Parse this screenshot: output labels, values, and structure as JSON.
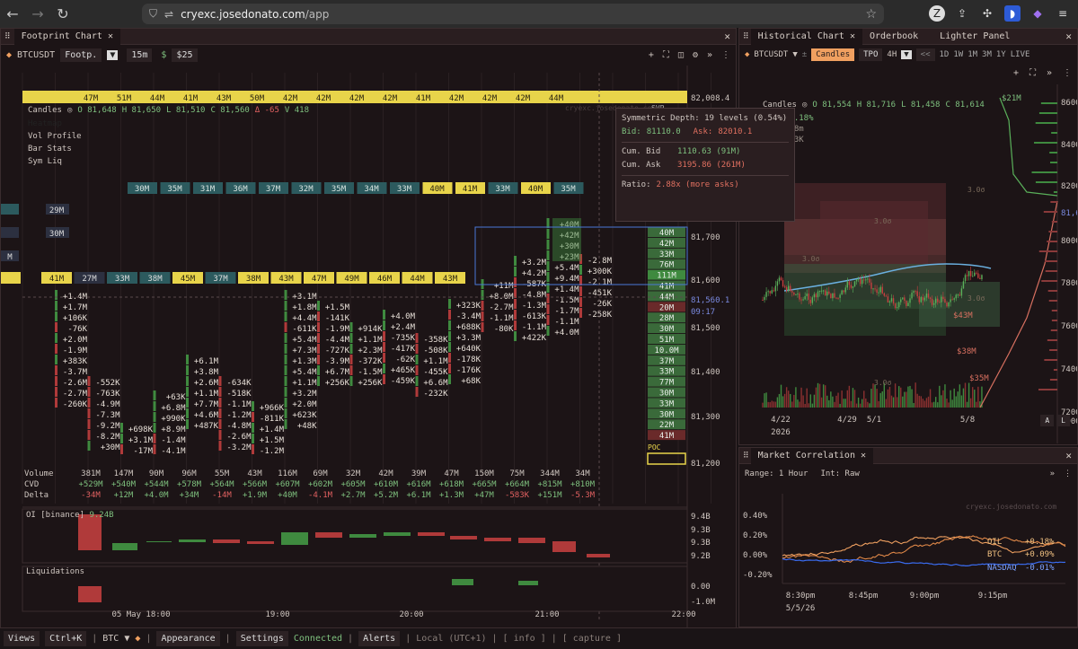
{
  "browser": {
    "url_domain": "cryexc.josedonato.com",
    "url_path": "/app",
    "back": "←",
    "forward": "→",
    "reload": "↻"
  },
  "left_panel": {
    "tab_label": "Footprint Chart",
    "symbol": "BTCUSDT",
    "mode": "Footp.",
    "interval": "15m",
    "currency_sign": "$",
    "step": "$25",
    "watermark": "cryexc.josedonato.com",
    "ohlc": {
      "label": "Candles",
      "o": "O 81,648",
      "h": "H 81,650",
      "l": "L 81,510",
      "c": "C 81,560",
      "d": "Δ -65",
      "v": "V 418"
    },
    "layers": [
      "Heatmap",
      "Vol Profile",
      "Bar Stats",
      "Sym Liq"
    ],
    "svp": "SVP",
    "tooltip": {
      "title": "Symmetric Depth: 19 levels (0.54%)",
      "bid_label": "Bid:",
      "bid": "81110.0",
      "ask_label": "Ask:",
      "ask": "82010.1",
      "cum_bid_label": "Cum. Bid",
      "cum_bid": "1110.63 (91M)",
      "cum_ask_label": "Cum. Ask",
      "cum_ask": "3195.86 (261M)",
      "ratio_label": "Ratio:",
      "ratio": "2.88x (more asks)"
    },
    "price_axis": [
      "82,008.4",
      "81,700",
      "81,600",
      "81,560.1",
      "09:17",
      "81,500",
      "81,400",
      "81,300",
      "81,200"
    ],
    "top_strip": [
      "47M",
      "51M",
      "44M",
      "41M",
      "43M",
      "50M",
      "42M",
      "42M",
      "42M",
      "42M",
      "41M",
      "42M",
      "42M",
      "42M",
      "44M"
    ],
    "mid_strip": [
      "30M",
      "35M",
      "31M",
      "36M",
      "37M",
      "32M",
      "35M",
      "34M",
      "33M",
      "40M",
      "41M",
      "33M",
      "40M",
      "35M"
    ],
    "low_strip": [
      "41M",
      "27M",
      "33M",
      "38M",
      "45M",
      "37M",
      "38M",
      "43M",
      "47M",
      "49M",
      "46M",
      "44M",
      "43M"
    ],
    "left_tags": [
      "29M",
      "30M",
      "M"
    ],
    "vp_values": [
      "40M",
      "42M",
      "33M",
      "76M",
      "111M",
      "41M",
      "44M",
      "20M",
      "28M",
      "30M",
      "51M",
      "10.0M",
      "37M",
      "33M",
      "77M",
      "30M",
      "33M",
      "30M",
      "22M",
      "41M"
    ],
    "poc_label": "POC",
    "stats_labels": [
      "Volume",
      "CVD",
      "Delta"
    ],
    "volume": [
      "381M",
      "147M",
      "90M",
      "96M",
      "55M",
      "43M",
      "116M",
      "69M",
      "32M",
      "42M",
      "39M",
      "47M",
      "150M",
      "75M",
      "344M",
      "34M"
    ],
    "cvd": [
      "+529M",
      "+540M",
      "+544M",
      "+578M",
      "+564M",
      "+566M",
      "+607M",
      "+602M",
      "+605M",
      "+610M",
      "+616M",
      "+618M",
      "+665M",
      "+664M",
      "+815M",
      "+810M"
    ],
    "delta": [
      "-34M",
      "+12M",
      "+4.0M",
      "+34M",
      "-14M",
      "+1.9M",
      "+40M",
      "-4.1M",
      "+2.7M",
      "+5.2M",
      "+6.1M",
      "+1.3M",
      "+47M",
      "-583K",
      "+151M",
      "-5.3M"
    ],
    "oi_label": "OI [binance] ",
    "oi_value": "9.24B",
    "oi_axis": [
      "9.4B",
      "9.3B",
      "9.3B",
      "9.2B"
    ],
    "liq_label": "Liquidations",
    "liq_axis": [
      "0.00",
      "-1.0M"
    ],
    "time_axis": [
      "05 May 18:00",
      "19:00",
      "20:00",
      "21:00",
      "22:00"
    ]
  },
  "right_top": {
    "tabs": [
      "Historical Chart",
      "Orderbook",
      "Lighter Panel"
    ],
    "symbol": "BTCUSDT",
    "mode": "Candles",
    "tpo": "TPO",
    "interval": "4H",
    "ranges": [
      "1D",
      "1W",
      "1M",
      "3M",
      "1Y",
      "LIVE"
    ],
    "back": "<<",
    "ohlc": {
      "label": "Candles",
      "o": "O 81,554",
      "h": "H 81,716",
      "l": "L 81,458",
      "c": "C 81,614"
    },
    "extra": [
      "+2.18%",
      "s 8m",
      "3.3K"
    ],
    "price_axis": [
      "86000",
      "84000",
      "82000",
      "81,614",
      "80000",
      "78000",
      "76000",
      "74000",
      "72000",
      "70000"
    ],
    "sigma": [
      "3.0σ",
      "3.0σ",
      "3.0σ",
      "3.0σ",
      "3.0σ"
    ],
    "liq_tags": [
      "$21M",
      "$43M",
      "$38M",
      "$35M"
    ],
    "dates": [
      "4/22",
      "4/29",
      "5/1",
      "5/8"
    ],
    "year": "2026",
    "scale_btns": [
      "A",
      "L"
    ]
  },
  "right_bottom": {
    "tab": "Market Correlation",
    "range": "Range: 1 Hour",
    "interval": "Int: Raw",
    "watermark": "cryexc.josedonato.com",
    "y_axis": [
      "0.40%",
      "0.20%",
      "0.00%",
      "-0.20%"
    ],
    "x_axis": [
      "8:30pm",
      "8:45pm",
      "9:00pm",
      "9:15pm"
    ],
    "date": "5/5/26",
    "legend": [
      {
        "name": "OIL",
        "value": "+0.18%",
        "color": "#f0a060"
      },
      {
        "name": "BTC",
        "value": "+0.09%",
        "color": "#f0a060"
      },
      {
        "name": "NASDAQ",
        "value": "-0.01%",
        "color": "#3a6cf0"
      }
    ]
  },
  "bottom_bar": {
    "views": "Views",
    "shortcut": "Ctrl+K",
    "btc": "BTC ▼",
    "appearance": "Appearance",
    "settings": "Settings",
    "status": "Connected",
    "alerts": "Alerts",
    "tz": "Local (UTC+1)",
    "info": "[ info ]",
    "capture": "[ capture ]"
  },
  "colors": {
    "accent": "#f0a060",
    "green": "#3f8a3f",
    "red": "#b03a3a",
    "yellow": "#e8d44a",
    "teal": "#2c5a5e",
    "bg": "#1c1416"
  }
}
